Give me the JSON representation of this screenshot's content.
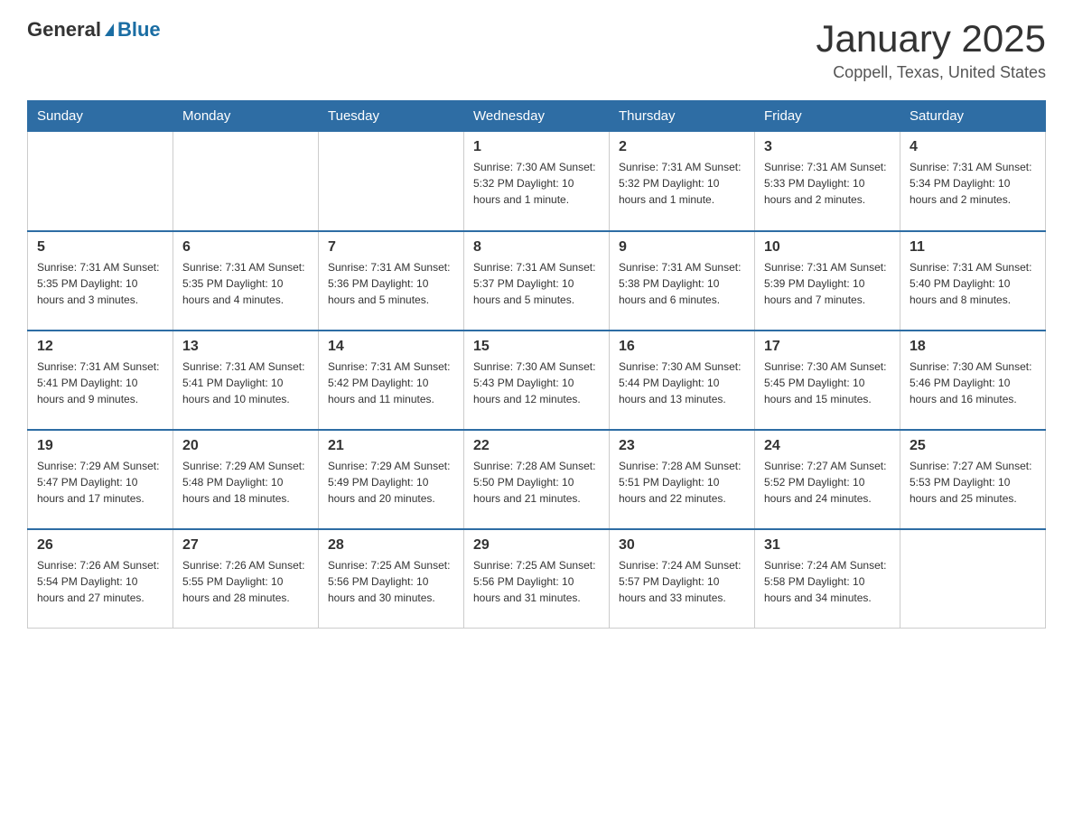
{
  "header": {
    "logo_general": "General",
    "logo_blue": "Blue",
    "title": "January 2025",
    "subtitle": "Coppell, Texas, United States"
  },
  "weekdays": [
    "Sunday",
    "Monday",
    "Tuesday",
    "Wednesday",
    "Thursday",
    "Friday",
    "Saturday"
  ],
  "weeks": [
    [
      {
        "day": "",
        "info": ""
      },
      {
        "day": "",
        "info": ""
      },
      {
        "day": "",
        "info": ""
      },
      {
        "day": "1",
        "info": "Sunrise: 7:30 AM\nSunset: 5:32 PM\nDaylight: 10 hours and 1 minute."
      },
      {
        "day": "2",
        "info": "Sunrise: 7:31 AM\nSunset: 5:32 PM\nDaylight: 10 hours and 1 minute."
      },
      {
        "day": "3",
        "info": "Sunrise: 7:31 AM\nSunset: 5:33 PM\nDaylight: 10 hours and 2 minutes."
      },
      {
        "day": "4",
        "info": "Sunrise: 7:31 AM\nSunset: 5:34 PM\nDaylight: 10 hours and 2 minutes."
      }
    ],
    [
      {
        "day": "5",
        "info": "Sunrise: 7:31 AM\nSunset: 5:35 PM\nDaylight: 10 hours and 3 minutes."
      },
      {
        "day": "6",
        "info": "Sunrise: 7:31 AM\nSunset: 5:35 PM\nDaylight: 10 hours and 4 minutes."
      },
      {
        "day": "7",
        "info": "Sunrise: 7:31 AM\nSunset: 5:36 PM\nDaylight: 10 hours and 5 minutes."
      },
      {
        "day": "8",
        "info": "Sunrise: 7:31 AM\nSunset: 5:37 PM\nDaylight: 10 hours and 5 minutes."
      },
      {
        "day": "9",
        "info": "Sunrise: 7:31 AM\nSunset: 5:38 PM\nDaylight: 10 hours and 6 minutes."
      },
      {
        "day": "10",
        "info": "Sunrise: 7:31 AM\nSunset: 5:39 PM\nDaylight: 10 hours and 7 minutes."
      },
      {
        "day": "11",
        "info": "Sunrise: 7:31 AM\nSunset: 5:40 PM\nDaylight: 10 hours and 8 minutes."
      }
    ],
    [
      {
        "day": "12",
        "info": "Sunrise: 7:31 AM\nSunset: 5:41 PM\nDaylight: 10 hours and 9 minutes."
      },
      {
        "day": "13",
        "info": "Sunrise: 7:31 AM\nSunset: 5:41 PM\nDaylight: 10 hours and 10 minutes."
      },
      {
        "day": "14",
        "info": "Sunrise: 7:31 AM\nSunset: 5:42 PM\nDaylight: 10 hours and 11 minutes."
      },
      {
        "day": "15",
        "info": "Sunrise: 7:30 AM\nSunset: 5:43 PM\nDaylight: 10 hours and 12 minutes."
      },
      {
        "day": "16",
        "info": "Sunrise: 7:30 AM\nSunset: 5:44 PM\nDaylight: 10 hours and 13 minutes."
      },
      {
        "day": "17",
        "info": "Sunrise: 7:30 AM\nSunset: 5:45 PM\nDaylight: 10 hours and 15 minutes."
      },
      {
        "day": "18",
        "info": "Sunrise: 7:30 AM\nSunset: 5:46 PM\nDaylight: 10 hours and 16 minutes."
      }
    ],
    [
      {
        "day": "19",
        "info": "Sunrise: 7:29 AM\nSunset: 5:47 PM\nDaylight: 10 hours and 17 minutes."
      },
      {
        "day": "20",
        "info": "Sunrise: 7:29 AM\nSunset: 5:48 PM\nDaylight: 10 hours and 18 minutes."
      },
      {
        "day": "21",
        "info": "Sunrise: 7:29 AM\nSunset: 5:49 PM\nDaylight: 10 hours and 20 minutes."
      },
      {
        "day": "22",
        "info": "Sunrise: 7:28 AM\nSunset: 5:50 PM\nDaylight: 10 hours and 21 minutes."
      },
      {
        "day": "23",
        "info": "Sunrise: 7:28 AM\nSunset: 5:51 PM\nDaylight: 10 hours and 22 minutes."
      },
      {
        "day": "24",
        "info": "Sunrise: 7:27 AM\nSunset: 5:52 PM\nDaylight: 10 hours and 24 minutes."
      },
      {
        "day": "25",
        "info": "Sunrise: 7:27 AM\nSunset: 5:53 PM\nDaylight: 10 hours and 25 minutes."
      }
    ],
    [
      {
        "day": "26",
        "info": "Sunrise: 7:26 AM\nSunset: 5:54 PM\nDaylight: 10 hours and 27 minutes."
      },
      {
        "day": "27",
        "info": "Sunrise: 7:26 AM\nSunset: 5:55 PM\nDaylight: 10 hours and 28 minutes."
      },
      {
        "day": "28",
        "info": "Sunrise: 7:25 AM\nSunset: 5:56 PM\nDaylight: 10 hours and 30 minutes."
      },
      {
        "day": "29",
        "info": "Sunrise: 7:25 AM\nSunset: 5:56 PM\nDaylight: 10 hours and 31 minutes."
      },
      {
        "day": "30",
        "info": "Sunrise: 7:24 AM\nSunset: 5:57 PM\nDaylight: 10 hours and 33 minutes."
      },
      {
        "day": "31",
        "info": "Sunrise: 7:24 AM\nSunset: 5:58 PM\nDaylight: 10 hours and 34 minutes."
      },
      {
        "day": "",
        "info": ""
      }
    ]
  ]
}
